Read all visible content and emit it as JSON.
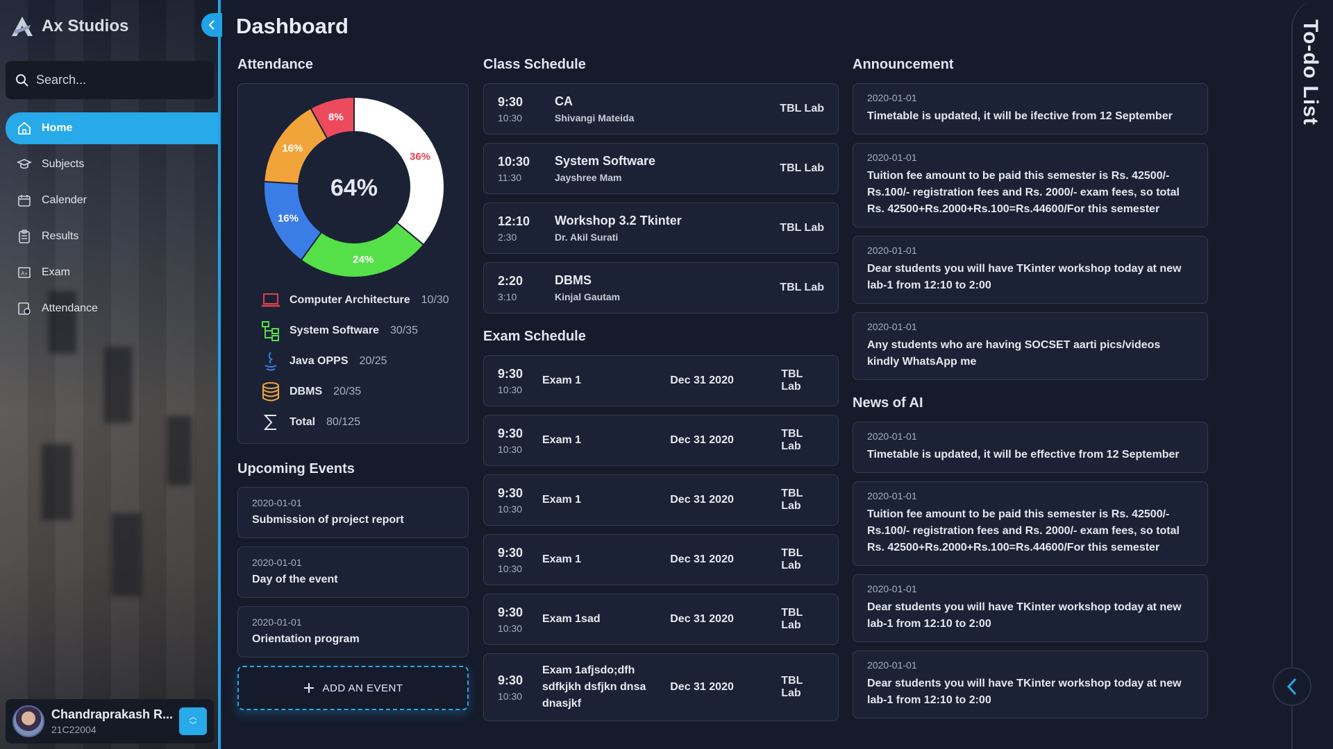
{
  "brand": {
    "name": "Ax Studios"
  },
  "search": {
    "placeholder": "Search..."
  },
  "nav": {
    "items": [
      {
        "label": "Home",
        "icon": "home-icon",
        "active": true
      },
      {
        "label": "Subjects",
        "icon": "graduation-cap-icon"
      },
      {
        "label": "Calender",
        "icon": "calendar-icon"
      },
      {
        "label": "Results",
        "icon": "clipboard-icon"
      },
      {
        "label": "Exam",
        "icon": "exam-icon"
      },
      {
        "label": "Attendance",
        "icon": "attendance-icon"
      }
    ]
  },
  "user": {
    "name": "Chandraprakash R...",
    "id": "21C22004"
  },
  "page": {
    "title": "Dashboard"
  },
  "sections": {
    "attendance": "Attendance",
    "class_schedule": "Class Schedule",
    "announcement": "Announcement",
    "upcoming_events": "Upcoming Events",
    "exam_schedule": "Exam Schedule",
    "news": "News of AI",
    "todo": "To-do List"
  },
  "attendance": {
    "center_label": "64%",
    "slices": [
      {
        "label": "36%",
        "value": 36,
        "color": "#ffffff"
      },
      {
        "label": "24%",
        "value": 24,
        "color": "#55e04a"
      },
      {
        "label": "16%",
        "value": 16,
        "color": "#3b7de6"
      },
      {
        "label": "16%",
        "value": 16,
        "color": "#f0a43a"
      },
      {
        "label": "8%",
        "value": 8,
        "color": "#ee4a5d"
      }
    ],
    "subjects": [
      {
        "name": "Computer Architecture",
        "count": "10/30",
        "icon": "laptop-icon"
      },
      {
        "name": "System Software",
        "count": "30/35",
        "icon": "hierarchy-icon"
      },
      {
        "name": "Java OPPS",
        "count": "20/25",
        "icon": "java-icon"
      },
      {
        "name": "DBMS",
        "count": "20/35",
        "icon": "database-icon"
      },
      {
        "name": "Total",
        "count": "80/125",
        "icon": "sigma-icon"
      }
    ]
  },
  "events": [
    {
      "date": "2020-01-01",
      "text": "Submission of project report"
    },
    {
      "date": "2020-01-01",
      "text": "Day of the event"
    },
    {
      "date": "2020-01-01",
      "text": "Orientation program"
    }
  ],
  "add_event_label": "ADD AN EVENT",
  "classes": [
    {
      "start": "9:30",
      "end": "10:30",
      "subject": "CA",
      "teacher": "Shivangi Mateida",
      "room": "TBL Lab"
    },
    {
      "start": "10:30",
      "end": "11:30",
      "subject": "System Software",
      "teacher": "Jayshree Mam",
      "room": "TBL Lab"
    },
    {
      "start": "12:10",
      "end": "2:30",
      "subject": "Workshop 3.2 Tkinter",
      "teacher": "Dr. Akil Surati",
      "room": "TBL Lab"
    },
    {
      "start": "2:20",
      "end": "3:10",
      "subject": "DBMS",
      "teacher": "Kinjal Gautam",
      "room": "TBL Lab"
    }
  ],
  "exams": [
    {
      "start": "9:30",
      "end": "10:30",
      "name": "Exam 1",
      "date": "Dec 31 2020",
      "room": "TBL Lab"
    },
    {
      "start": "9:30",
      "end": "10:30",
      "name": "Exam 1",
      "date": "Dec 31 2020",
      "room": "TBL Lab"
    },
    {
      "start": "9:30",
      "end": "10:30",
      "name": "Exam 1",
      "date": "Dec 31 2020",
      "room": "TBL Lab"
    },
    {
      "start": "9:30",
      "end": "10:30",
      "name": "Exam 1",
      "date": "Dec 31 2020",
      "room": "TBL Lab"
    },
    {
      "start": "9:30",
      "end": "10:30",
      "name": "Exam 1sad",
      "date": "Dec 31 2020",
      "room": "TBL Lab"
    },
    {
      "start": "9:30",
      "end": "10:30",
      "name": "Exam 1afjsdo;dfh sdfkjkh dsfjkn dnsa dnasjkf",
      "date": "Dec 31 2020",
      "room": "TBL Lab"
    }
  ],
  "announcements": [
    {
      "date": "2020-01-01",
      "text": "Timetable is updated, it will be ifective from 12 September"
    },
    {
      "date": "2020-01-01",
      "text": "Tuition fee amount to be paid this semester is Rs. 42500/- Rs.100/- registration fees and Rs. 2000/- exam fees, so total Rs. 42500+Rs.2000+Rs.100=Rs.44600/For this semester"
    },
    {
      "date": "2020-01-01",
      "text": "Dear students you will have TKinter workshop today at new lab-1 from 12:10 to 2:00"
    },
    {
      "date": "2020-01-01",
      "text": "Any students who are having SOCSET aarti pics/videos kindly WhatsApp me"
    }
  ],
  "news": [
    {
      "date": "2020-01-01",
      "text": "Timetable is updated, it will be effective from 12 September"
    },
    {
      "date": "2020-01-01",
      "text": "Tuition fee amount to be paid this semester is Rs. 42500/- Rs.100/- registration fees and Rs. 2000/- exam fees, so total Rs. 42500+Rs.2000+Rs.100=Rs.44600/For this semester"
    },
    {
      "date": "2020-01-01",
      "text": "Dear students you will have TKinter workshop today at new lab-1 from 12:10 to 2:00"
    },
    {
      "date": "2020-01-01",
      "text": "Dear students you will have TKinter workshop today at new lab-1 from 12:10 to 2:00"
    }
  ],
  "colors": {
    "accent": "#27a9ea",
    "background": "#161b2b",
    "card": "#1b2235"
  }
}
